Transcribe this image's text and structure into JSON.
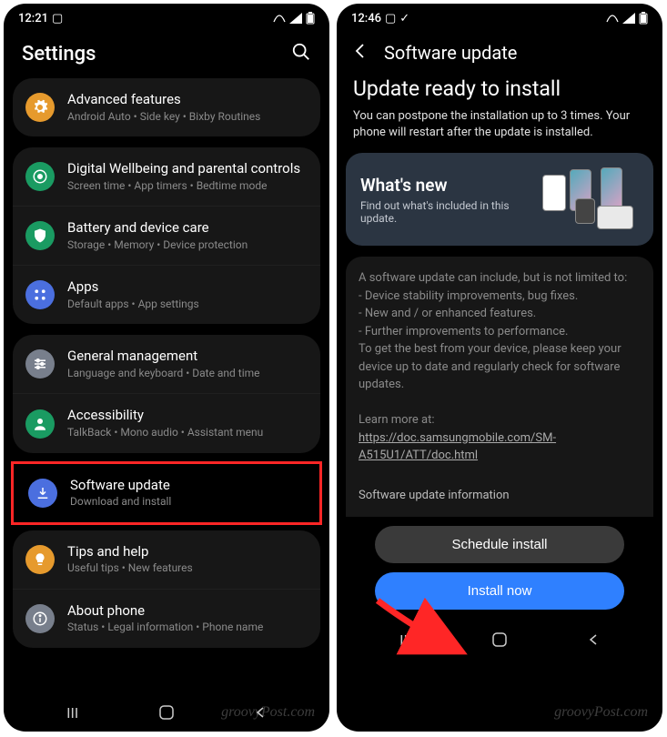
{
  "left": {
    "status_time": "12:21",
    "title": "Settings",
    "groups": [
      {
        "rows": [
          {
            "id": "advanced-features",
            "icon": "gear",
            "bg": "#e69a2d",
            "title": "Advanced features",
            "sub": "Android Auto  •  Side key  •  Bixby Routines"
          }
        ]
      },
      {
        "rows": [
          {
            "id": "digital-wellbeing",
            "icon": "circle-dot",
            "bg": "#1a9b62",
            "title": "Digital Wellbeing and parental controls",
            "sub": "Screen time  •  App timers  •  Bedtime mode"
          },
          {
            "id": "battery-care",
            "icon": "shield",
            "bg": "#1a9b62",
            "title": "Battery and device care",
            "sub": "Storage  •  Memory  •  Device protection"
          },
          {
            "id": "apps",
            "icon": "grid",
            "bg": "#4b6fdf",
            "title": "Apps",
            "sub": "Default apps  •  App settings"
          }
        ]
      },
      {
        "rows": [
          {
            "id": "general-management",
            "icon": "sliders",
            "bg": "#787f8c",
            "title": "General management",
            "sub": "Language and keyboard  •  Date and time"
          },
          {
            "id": "accessibility",
            "icon": "person",
            "bg": "#1a9b62",
            "title": "Accessibility",
            "sub": "TalkBack  •  Mono audio  •  Assistant menu"
          }
        ]
      },
      {
        "highlight": true,
        "rows": [
          {
            "id": "software-update",
            "icon": "download",
            "bg": "#4b6fdf",
            "title": "Software update",
            "sub": "Download and install"
          }
        ]
      },
      {
        "rows": [
          {
            "id": "tips-help",
            "icon": "bulb",
            "bg": "#e69a2d",
            "title": "Tips and help",
            "sub": "Useful tips  •  New features"
          },
          {
            "id": "about-phone",
            "icon": "info",
            "bg": "#787f8c",
            "title": "About phone",
            "sub": "Status  •  Legal information  •  Phone name"
          }
        ]
      }
    ]
  },
  "right": {
    "status_time": "12:46",
    "title": "Software update",
    "heading": "Update ready to install",
    "desc": "You can postpone the installation up to 3 times. Your phone will restart after the update is installed.",
    "whatsnew_title": "What's new",
    "whatsnew_sub": "Find out what's included in this update.",
    "detail_lead": "A software update can include, but is not limited to:",
    "detail_items": [
      "Device stability improvements, bug fixes.",
      "New and / or enhanced features.",
      "Further improvements to performance."
    ],
    "detail_more": "To get the best from your device, please keep your device up to date and regularly check for software updates.",
    "detail_learn": "Learn more at:",
    "detail_link": "https://doc.samsungmobile.com/SM-A515U1/ATT/doc.html",
    "info_label": "Software update information",
    "btn_schedule": "Schedule install",
    "btn_install": "Install now"
  },
  "watermark": "groovyPost.com"
}
